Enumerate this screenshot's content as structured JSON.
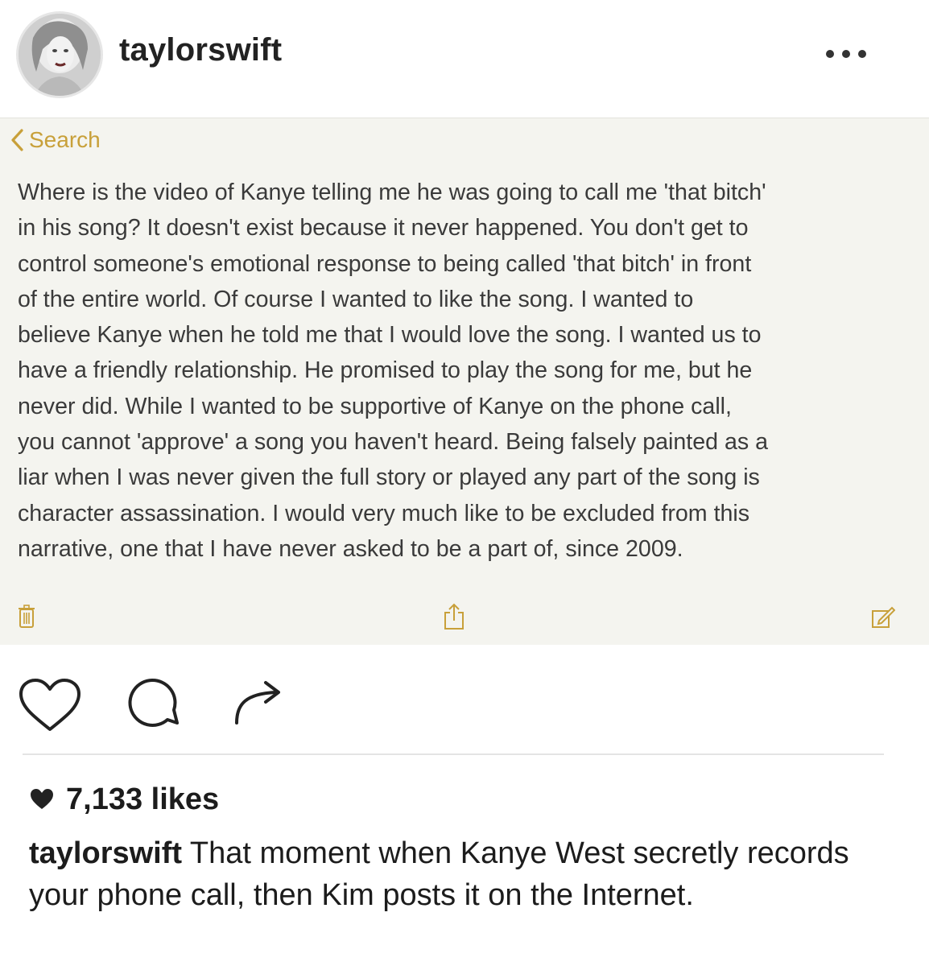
{
  "header": {
    "username": "taylorswift",
    "avatar_icon": "profile-photo"
  },
  "notes": {
    "back_label": "Search",
    "body": "Where is the video of Kanye telling me he was going to call me 'that bitch'\nin his song? It doesn't exist because it never happened. You don't get to\ncontrol someone's emotional response to being called 'that bitch' in front\nof the entire world. Of course I wanted to like the song. I wanted to\nbelieve Kanye when he told me that I would love the song. I wanted us to\nhave a friendly relationship. He promised to play the song for me, but he\nnever did. While I wanted to be supportive of Kanye on the phone call,\nyou cannot 'approve' a song you haven't heard. Being falsely painted as a\nliar when I was never given the full story or played any part of the song is\ncharacter assassination. I would very much like to be excluded from this\nnarrative, one that I have never asked to be a part of, since 2009.",
    "accent_color": "#c8a03a",
    "background_color": "#f4f4ef",
    "toolbar_icons": [
      "trash-icon",
      "share-icon",
      "compose-icon"
    ]
  },
  "actions": {
    "icons": [
      "heart-icon",
      "comment-icon",
      "share-arrow-icon"
    ]
  },
  "likes": {
    "count_text": "7,133 likes"
  },
  "caption": {
    "username": "taylorswift",
    "text": " That moment when Kanye West secretly records your phone call, then Kim posts it on the Internet."
  }
}
